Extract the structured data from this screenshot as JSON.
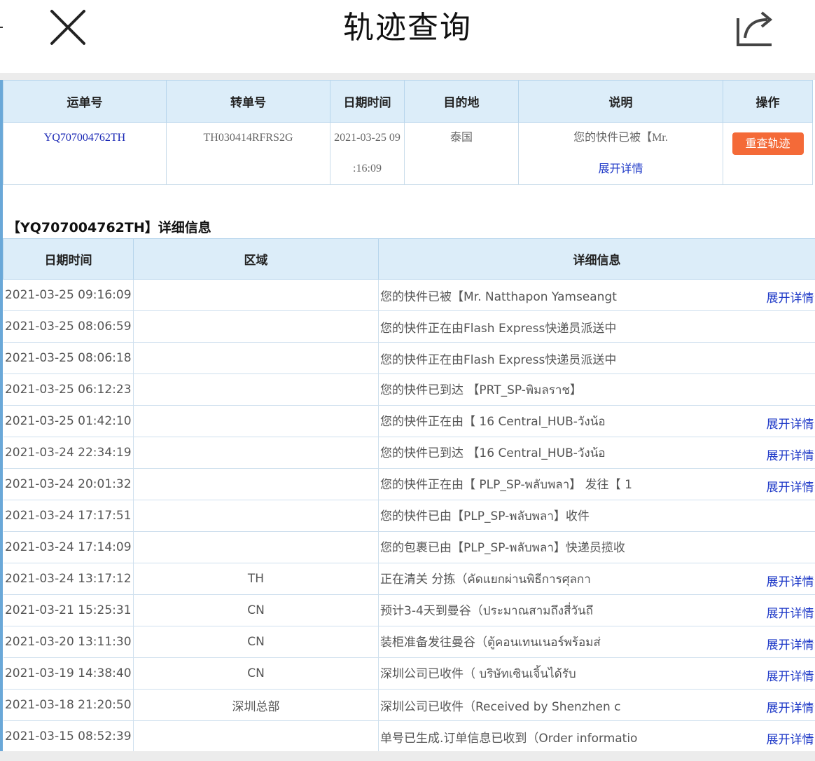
{
  "nav": {
    "title": "轨迹查询"
  },
  "summary": {
    "headers": {
      "waybill": "运单号",
      "transfer": "转单号",
      "datetime": "日期时间",
      "destination": "目的地",
      "description": "说明",
      "action": "操作"
    },
    "row": {
      "waybill": "YQ707004762TH",
      "transfer": "TH030414RFRS2G",
      "date_part1": "2021-03-25 09",
      "date_part2": ":16:09",
      "destination": "泰国",
      "description": "您的快件已被【Mr.",
      "expand": "展开详情",
      "retrack": "重查轨迹"
    }
  },
  "details": {
    "heading": "【YQ707004762TH】详细信息",
    "headers": {
      "datetime": "日期时间",
      "area": "区域",
      "info": "详细信息"
    },
    "expand_label": "展开详情",
    "rows": [
      {
        "date": "2021-03-25 09:16:09",
        "area": "",
        "info": "您的快件已被【Mr. Natthapon Yamseangt",
        "expand": true
      },
      {
        "date": "2021-03-25 08:06:59",
        "area": "",
        "info": " 您的快件正在由Flash Express快递员派送中",
        "expand": false
      },
      {
        "date": "2021-03-25 08:06:18",
        "area": "",
        "info": " 您的快件正在由Flash Express快递员派送中",
        "expand": false
      },
      {
        "date": "2021-03-25 06:12:23",
        "area": "",
        "info": " 您的快件已到达 【PRT_SP-พิมลราช】",
        "expand": false
      },
      {
        "date": "2021-03-25 01:42:10",
        "area": "",
        "info": "您的快件正在由【 16 Central_HUB-วังน้อ",
        "expand": true
      },
      {
        "date": "2021-03-24 22:34:19",
        "area": "",
        "info": "您的快件已到达 【16 Central_HUB-วังน้อ",
        "expand": true
      },
      {
        "date": "2021-03-24 20:01:32",
        "area": "",
        "info": "您的快件正在由【 PLP_SP-พลับพลา】 发往【 1",
        "expand": true
      },
      {
        "date": "2021-03-24 17:17:51",
        "area": "",
        "info": " 您的快件已由【PLP_SP-พลับพลา】收件",
        "expand": false
      },
      {
        "date": "2021-03-24 17:14:09",
        "area": "",
        "info": " 您的包裹已由【PLP_SP-พลับพลา】快递员揽收",
        "expand": false
      },
      {
        "date": "2021-03-24 13:17:12",
        "area": "TH",
        "info": "正在清关 分拣（คัดแยกผ่านพิธีการศุลกา",
        "expand": true
      },
      {
        "date": "2021-03-21 15:25:31",
        "area": "CN",
        "info": "预计3-4天到曼谷（ประมาณสามถึงสี่วันถึ",
        "expand": true
      },
      {
        "date": "2021-03-20 13:11:30",
        "area": "CN",
        "info": "装柜准备发往曼谷（ตู้คอนเทนเนอร์พร้อมส่",
        "expand": true
      },
      {
        "date": "2021-03-19 14:38:40",
        "area": "CN",
        "info": "深圳公司已收件（ บริษัทเซินเจิ้นได้รับ",
        "expand": true
      },
      {
        "date": "2021-03-18 21:20:50",
        "area": "深圳总部",
        "info": "深圳公司已收件（Received by Shenzhen c",
        "expand": true
      },
      {
        "date": "2021-03-15 08:52:39",
        "area": "",
        "info": "单号已生成.订单信息已收到（Order informatio",
        "expand": true
      }
    ]
  },
  "colors": {
    "header_bg": "#dcedf9",
    "link": "#1c37c7",
    "button": "#f46a38"
  }
}
